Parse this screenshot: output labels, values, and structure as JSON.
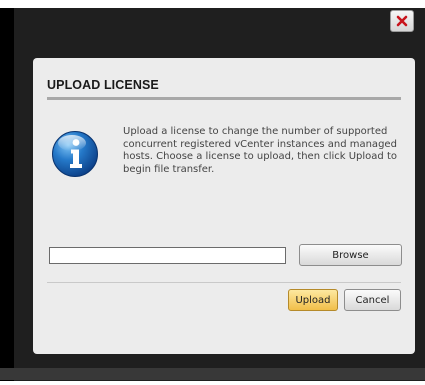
{
  "window": {
    "close_icon": "close-x-icon",
    "close_color": "#c8141c"
  },
  "dialog": {
    "title": "UPLOAD LICENSE",
    "icon": "info-icon",
    "message": "Upload a license to change the number of supported concurrent registered vCenter instances and managed hosts. Choose a license to upload, then click Upload to begin file transfer.",
    "file_input": {
      "value": "",
      "placeholder": ""
    },
    "browse_label": "Browse",
    "upload_label": "Upload",
    "cancel_label": "Cancel",
    "accent_color": "#f1bf4a"
  }
}
